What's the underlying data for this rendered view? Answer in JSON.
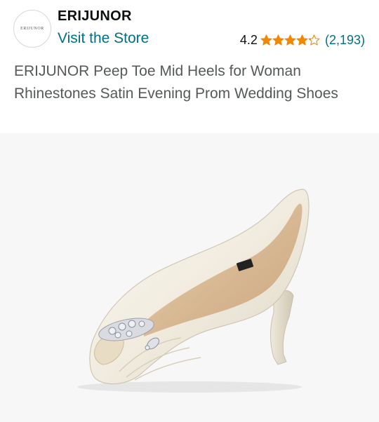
{
  "store": {
    "logo_text": "ERIJUNOR",
    "brand": "ERIJUNOR",
    "visit_link": "Visit the Store"
  },
  "rating": {
    "value": "4.2",
    "stars_filled": 4.2,
    "stars_max": 5,
    "count": "(2,193)",
    "star_color": "#f08804"
  },
  "product": {
    "title": "ERIJUNOR Peep Toe Mid Heels for Woman Rhinestones Satin Evening Prom Wedding Shoes",
    "image": "ivory-satin-peep-toe-heel-with-rhinestone-brooch"
  },
  "colors": {
    "link": "#007185",
    "title_text": "#565959",
    "image_bg": "#f7f7f7"
  }
}
